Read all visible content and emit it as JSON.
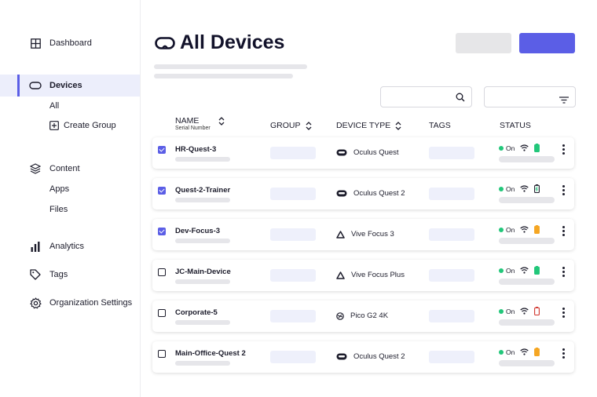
{
  "sidebar": {
    "items": [
      {
        "label": "Dashboard",
        "icon": "grid-icon"
      },
      {
        "label": "Devices",
        "icon": "headset-icon",
        "active": true
      },
      {
        "label": "Content",
        "icon": "layers-icon"
      },
      {
        "label": "Analytics",
        "icon": "bar-chart-icon"
      },
      {
        "label": "Tags",
        "icon": "tag-icon"
      },
      {
        "label": "Organization Settings",
        "icon": "gear-icon"
      }
    ],
    "devices_sub": [
      "All",
      "Create Group"
    ],
    "content_sub": [
      "Apps",
      "Files"
    ]
  },
  "page": {
    "title": "All Devices",
    "icon": "headset-icon"
  },
  "table": {
    "headers": {
      "name": "NAME",
      "serial": "Serial Number",
      "group": "GROUP",
      "device_type": "DEVICE TYPE",
      "tags": "TAGS",
      "status": "STATUS"
    },
    "rows": [
      {
        "checked": true,
        "name": "HR-Quest-3",
        "type": "Oculus Quest",
        "type_icon": "headset-icon",
        "status": "On",
        "battery": "green"
      },
      {
        "checked": true,
        "name": "Quest-2-Trainer",
        "type": "Oculus Quest 2",
        "type_icon": "headset-icon",
        "status": "On",
        "battery": "charging"
      },
      {
        "checked": true,
        "name": "Dev-Focus-3",
        "type": "Vive Focus 3",
        "type_icon": "triangle-icon",
        "status": "On",
        "battery": "orange"
      },
      {
        "checked": false,
        "name": "JC-Main-Device",
        "type": "Vive Focus Plus",
        "type_icon": "triangle-icon",
        "status": "On",
        "battery": "green"
      },
      {
        "checked": false,
        "name": "Corporate-5",
        "type": "Pico G2 4K",
        "type_icon": "pico-icon",
        "status": "On",
        "battery": "red"
      },
      {
        "checked": false,
        "name": "Main-Office-Quest 2",
        "type": "Oculus Quest 2",
        "type_icon": "headset-icon",
        "status": "On",
        "battery": "orange"
      }
    ]
  },
  "colors": {
    "accent": "#5b5ee6",
    "online": "#22c77a",
    "battery_green": "#22c77a",
    "battery_orange": "#f5a623",
    "battery_red": "#d0342c"
  }
}
